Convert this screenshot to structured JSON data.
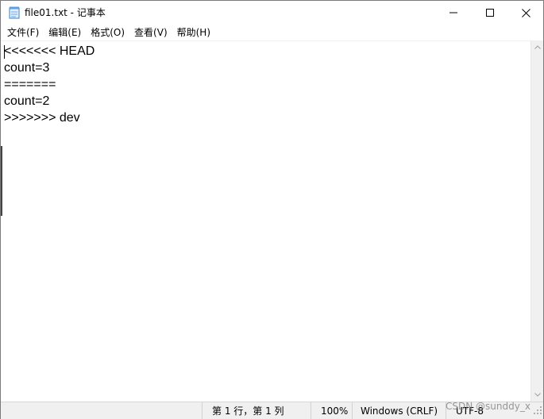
{
  "window": {
    "title": "file01.txt - 记事本"
  },
  "menu": {
    "items": [
      "文件(F)",
      "编辑(E)",
      "格式(O)",
      "查看(V)",
      "帮助(H)"
    ]
  },
  "editor": {
    "lines": [
      "<<<<<<< HEAD",
      "count=3",
      "=======",
      "count=2",
      ">>>>>>> dev"
    ]
  },
  "status": {
    "position": "第 1 行，第 1 列",
    "zoom": "100%",
    "line_ending": "Windows (CRLF)",
    "encoding": "UTF-8"
  },
  "watermark": "CSDN @sunddy_x",
  "icons": {
    "app": "notepad-icon",
    "minimize": "minimize-icon",
    "maximize": "maximize-icon",
    "close": "close-icon",
    "scroll_up": "chevron-up-icon",
    "scroll_down": "chevron-down-icon"
  },
  "colors": {
    "chrome": "#f0f0f0",
    "text": "#000000"
  }
}
